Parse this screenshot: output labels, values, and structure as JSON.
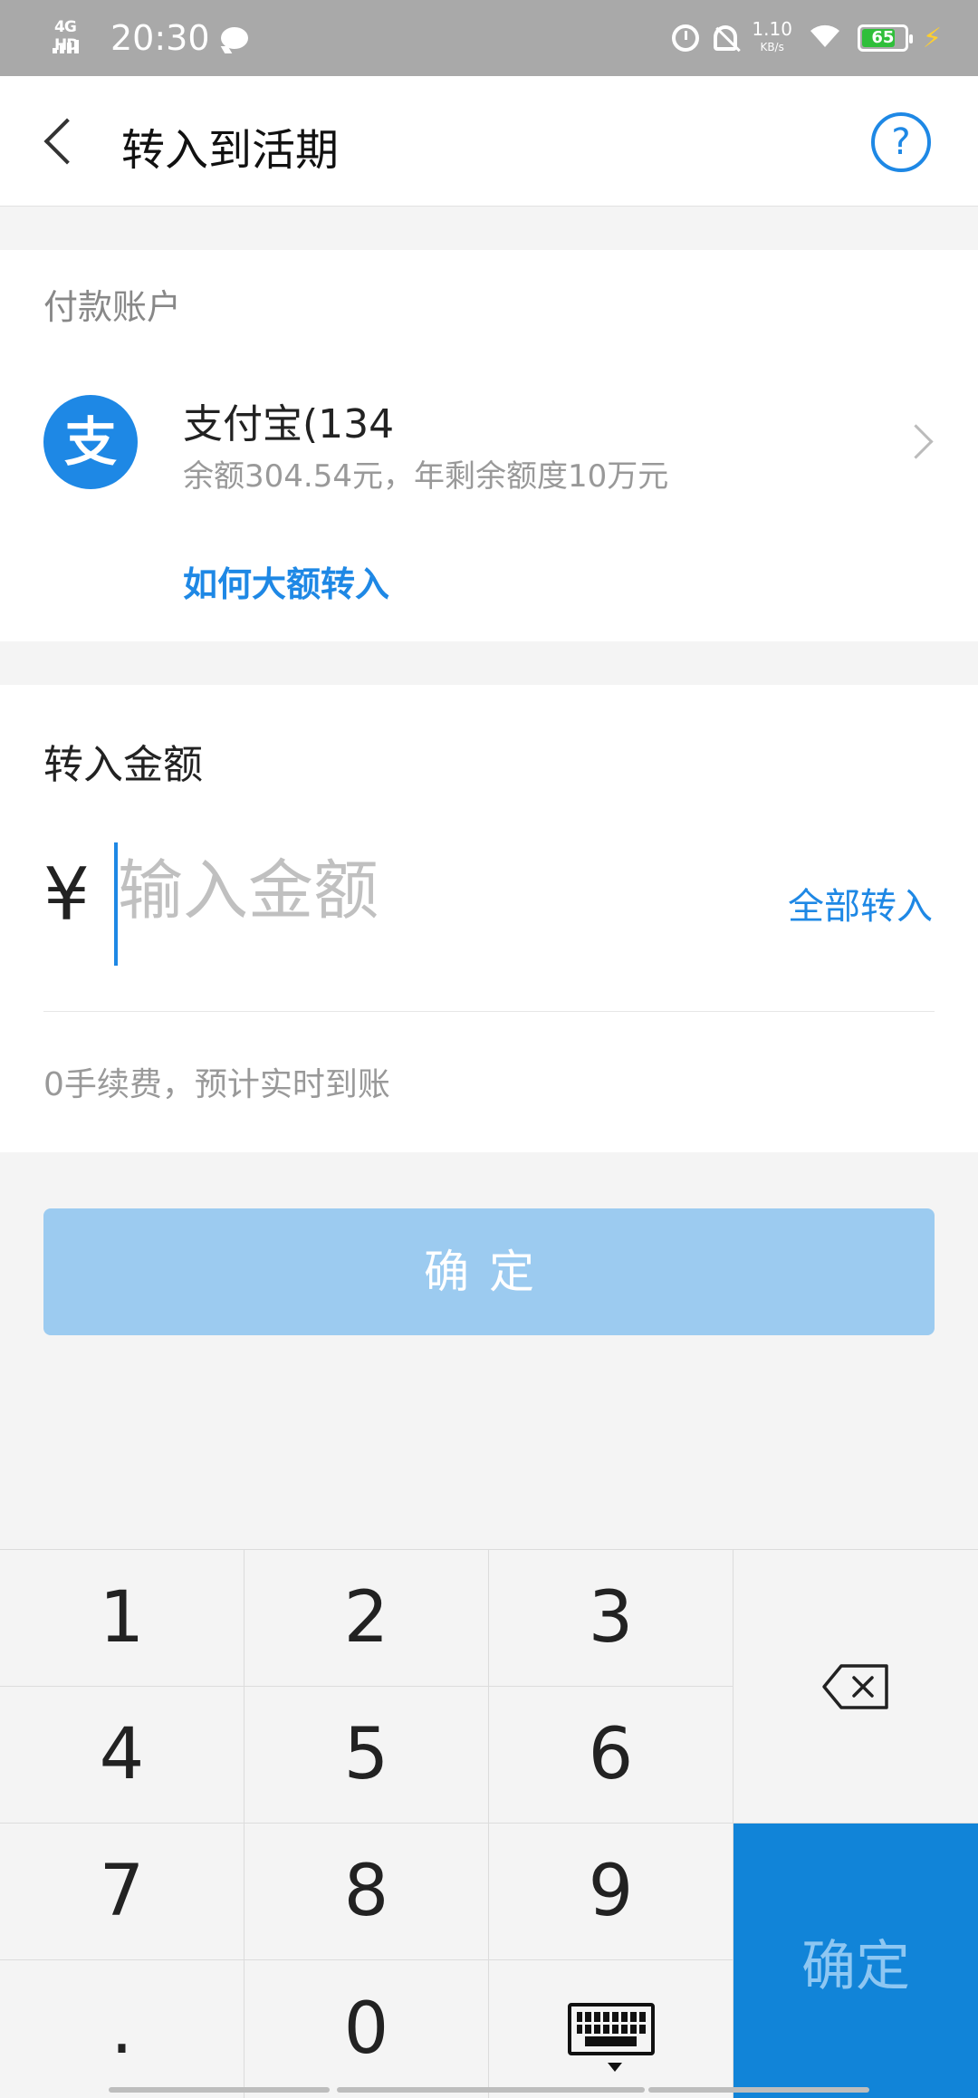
{
  "status_bar": {
    "network": "4G HD",
    "time": "20:30",
    "speed": "1.10",
    "speed_unit": "KB/s",
    "battery": "65"
  },
  "header": {
    "title": "转入到活期",
    "help_glyph": "?"
  },
  "payment_account": {
    "section_label": "付款账户",
    "logo_glyph": "支",
    "name": "支付宝(134",
    "sub": "余额304.54元，年剩余额度10万元",
    "large_transfer_link": "如何大额转入"
  },
  "amount": {
    "title": "转入金额",
    "currency_symbol": "¥",
    "placeholder": "输入金额",
    "value": "",
    "transfer_all": "全部转入",
    "fee_note": "0手续费，预计实时到账"
  },
  "confirm_button": {
    "label": "确定"
  },
  "keypad": {
    "k1": "1",
    "k2": "2",
    "k3": "3",
    "k4": "4",
    "k5": "5",
    "k6": "6",
    "k7": "7",
    "k8": "8",
    "k9": "9",
    "kdot": ".",
    "k0": "0",
    "ok": "确定"
  },
  "colors": {
    "accent": "#1e88e5",
    "confirm_disabled": "#9ccbf0",
    "keypad_ok": "#1184d8"
  }
}
